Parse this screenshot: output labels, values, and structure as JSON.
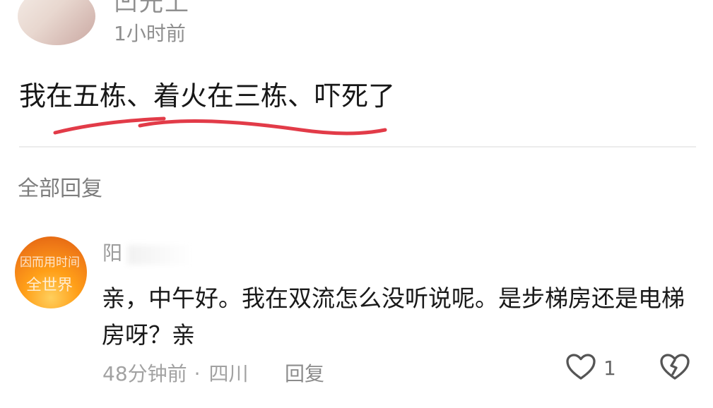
{
  "top_comment": {
    "name": "凹光上",
    "time": "1小时前",
    "text": "我在五栋、着火在三栋、吓死了"
  },
  "section": {
    "title": "全部回复"
  },
  "reply": {
    "name": "阳",
    "avatar_text_1": "因而用时间",
    "avatar_text_2": "全世界",
    "text": "亲，中午好。我在双流怎么没听说呢。是步梯房还是电梯房呀？亲",
    "time": "48分钟前",
    "separator": "·",
    "location": "四川",
    "reply_label": "回复",
    "like_count": "1"
  },
  "icons": {
    "like": "heart-outline-icon",
    "dislike": "broken-heart-icon"
  },
  "colors": {
    "annotation_red": "#e23b48",
    "muted_text": "#8f8f8f"
  }
}
